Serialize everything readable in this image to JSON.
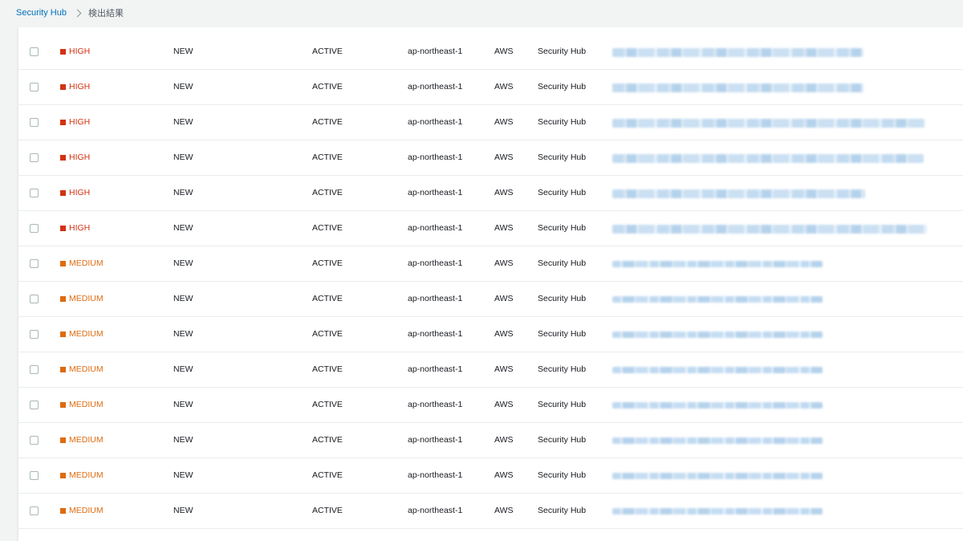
{
  "breadcrumb": {
    "root": "Security Hub",
    "current": "検出結果"
  },
  "colors": {
    "high": "#d13212",
    "medium": "#dd6b10",
    "link": "#0073bb"
  },
  "findings": [
    {
      "severity": "HIGH",
      "workflow": "NEW",
      "record_state": "ACTIVE",
      "region": "ap-northeast-1",
      "account": "AWS",
      "product": "Security Hub"
    },
    {
      "severity": "HIGH",
      "workflow": "NEW",
      "record_state": "ACTIVE",
      "region": "ap-northeast-1",
      "account": "AWS",
      "product": "Security Hub"
    },
    {
      "severity": "HIGH",
      "workflow": "NEW",
      "record_state": "ACTIVE",
      "region": "ap-northeast-1",
      "account": "AWS",
      "product": "Security Hub"
    },
    {
      "severity": "HIGH",
      "workflow": "NEW",
      "record_state": "ACTIVE",
      "region": "ap-northeast-1",
      "account": "AWS",
      "product": "Security Hub"
    },
    {
      "severity": "HIGH",
      "workflow": "NEW",
      "record_state": "ACTIVE",
      "region": "ap-northeast-1",
      "account": "AWS",
      "product": "Security Hub"
    },
    {
      "severity": "HIGH",
      "workflow": "NEW",
      "record_state": "ACTIVE",
      "region": "ap-northeast-1",
      "account": "AWS",
      "product": "Security Hub"
    },
    {
      "severity": "MEDIUM",
      "workflow": "NEW",
      "record_state": "ACTIVE",
      "region": "ap-northeast-1",
      "account": "AWS",
      "product": "Security Hub"
    },
    {
      "severity": "MEDIUM",
      "workflow": "NEW",
      "record_state": "ACTIVE",
      "region": "ap-northeast-1",
      "account": "AWS",
      "product": "Security Hub"
    },
    {
      "severity": "MEDIUM",
      "workflow": "NEW",
      "record_state": "ACTIVE",
      "region": "ap-northeast-1",
      "account": "AWS",
      "product": "Security Hub"
    },
    {
      "severity": "MEDIUM",
      "workflow": "NEW",
      "record_state": "ACTIVE",
      "region": "ap-northeast-1",
      "account": "AWS",
      "product": "Security Hub"
    },
    {
      "severity": "MEDIUM",
      "workflow": "NEW",
      "record_state": "ACTIVE",
      "region": "ap-northeast-1",
      "account": "AWS",
      "product": "Security Hub"
    },
    {
      "severity": "MEDIUM",
      "workflow": "NEW",
      "record_state": "ACTIVE",
      "region": "ap-northeast-1",
      "account": "AWS",
      "product": "Security Hub"
    },
    {
      "severity": "MEDIUM",
      "workflow": "NEW",
      "record_state": "ACTIVE",
      "region": "ap-northeast-1",
      "account": "AWS",
      "product": "Security Hub"
    },
    {
      "severity": "MEDIUM",
      "workflow": "NEW",
      "record_state": "ACTIVE",
      "region": "ap-northeast-1",
      "account": "AWS",
      "product": "Security Hub"
    }
  ]
}
